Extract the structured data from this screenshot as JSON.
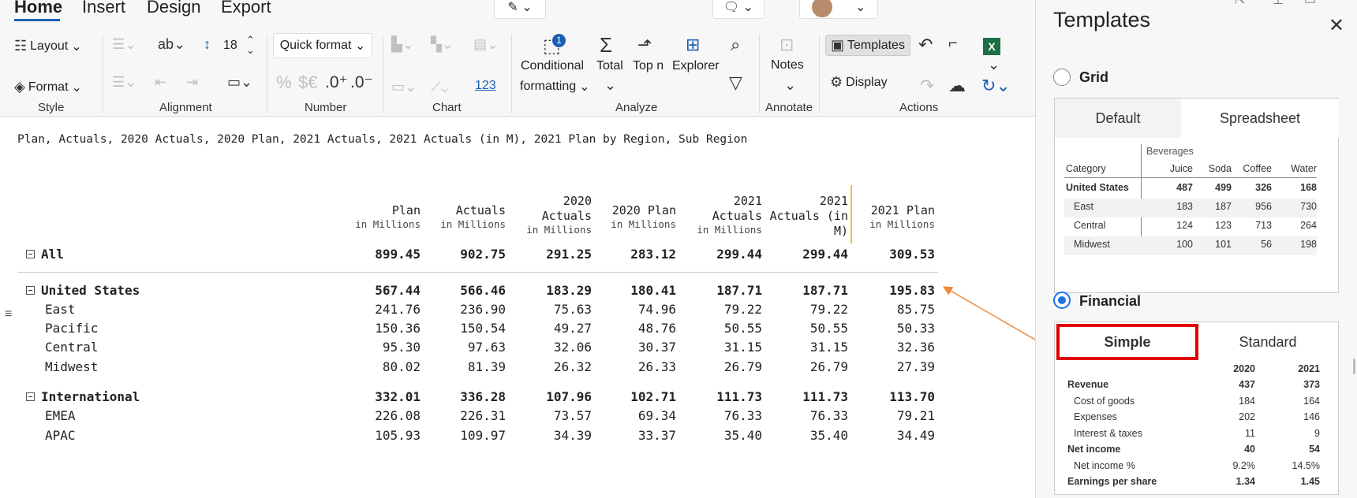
{
  "menu": {
    "home": "Home",
    "insert": "Insert",
    "design": "Design",
    "export": "Export"
  },
  "ribbon": {
    "style": {
      "layout": "Layout",
      "format": "Format",
      "label": "Style"
    },
    "alignment": {
      "label": "Alignment",
      "font_size": "18"
    },
    "number": {
      "quick_format": "Quick format",
      "label": "Number",
      "percent": "%",
      "currency": "$€",
      "inc_dec": ".0⁺",
      "dec_dec": ".0⁻"
    },
    "chart": {
      "label": "Chart",
      "num": "123"
    },
    "analyze": {
      "conditional1": "Conditional",
      "conditional2": "formatting",
      "badge": "1",
      "total": "Total",
      "topn": "Top n",
      "explorer": "Explorer",
      "label": "Analyze"
    },
    "annotate": {
      "notes": "Notes",
      "label": "Annotate"
    },
    "actions": {
      "templates": "Templates",
      "display": "Display",
      "label": "Actions"
    }
  },
  "formula": "Plan, Actuals, 2020 Actuals, 2020 Plan, 2021 Actuals, 2021 Actuals (in M), 2021 Plan by Region, Sub Region",
  "columns": [
    {
      "line1": "Plan",
      "line2": "",
      "sub": "in Millions"
    },
    {
      "line1": "Actuals",
      "line2": "",
      "sub": "in Millions"
    },
    {
      "line1": "2020",
      "line2": "Actuals",
      "sub": "in Millions"
    },
    {
      "line1": "2020 Plan",
      "line2": "",
      "sub": "in Millions"
    },
    {
      "line1": "2021",
      "line2": "Actuals",
      "sub": "in Millions"
    },
    {
      "line1": "2021",
      "line2": "Actuals (in",
      "sub": "M)"
    },
    {
      "line1": "2021 Plan",
      "line2": "",
      "sub": "in Millions"
    }
  ],
  "rows": [
    {
      "label": "All",
      "bold": true,
      "expand": true,
      "indent": 0,
      "values": [
        "899.45",
        "902.75",
        "291.25",
        "283.12",
        "299.44",
        "299.44",
        "309.53"
      ]
    },
    {
      "label": "United States",
      "bold": true,
      "expand": true,
      "indent": 0,
      "values": [
        "567.44",
        "566.46",
        "183.29",
        "180.41",
        "187.71",
        "187.71",
        "195.83"
      ]
    },
    {
      "label": "East",
      "bold": false,
      "expand": false,
      "indent": 1,
      "values": [
        "241.76",
        "236.90",
        "75.63",
        "74.96",
        "79.22",
        "79.22",
        "85.75"
      ]
    },
    {
      "label": "Pacific",
      "bold": false,
      "expand": false,
      "indent": 1,
      "values": [
        "150.36",
        "150.54",
        "49.27",
        "48.76",
        "50.55",
        "50.55",
        "50.33"
      ]
    },
    {
      "label": "Central",
      "bold": false,
      "expand": false,
      "indent": 1,
      "values": [
        "95.30",
        "97.63",
        "32.06",
        "30.37",
        "31.15",
        "31.15",
        "32.36"
      ]
    },
    {
      "label": "Midwest",
      "bold": false,
      "expand": false,
      "indent": 1,
      "values": [
        "80.02",
        "81.39",
        "26.32",
        "26.33",
        "26.79",
        "26.79",
        "27.39"
      ]
    },
    {
      "label": "International",
      "bold": true,
      "expand": true,
      "indent": 0,
      "values": [
        "332.01",
        "336.28",
        "107.96",
        "102.71",
        "111.73",
        "111.73",
        "113.70"
      ]
    },
    {
      "label": "EMEA",
      "bold": false,
      "expand": false,
      "indent": 1,
      "values": [
        "226.08",
        "226.31",
        "73.57",
        "69.34",
        "76.33",
        "76.33",
        "79.21"
      ]
    },
    {
      "label": "APAC",
      "bold": false,
      "expand": false,
      "indent": 1,
      "values": [
        "105.93",
        "109.97",
        "34.39",
        "33.37",
        "35.40",
        "35.40",
        "34.49"
      ]
    }
  ],
  "panel": {
    "title": "Templates",
    "grid": {
      "label": "Grid",
      "tabs": [
        "Default",
        "Spreadsheet"
      ],
      "group_header": "Beverages",
      "category_header": "Category",
      "columns": [
        "Juice",
        "Soda",
        "Coffee",
        "Water"
      ],
      "rows": [
        {
          "label": "United States",
          "bold": true,
          "values": [
            "487",
            "499",
            "326",
            "168"
          ]
        },
        {
          "label": "East",
          "bold": false,
          "values": [
            "183",
            "187",
            "956",
            "730"
          ]
        },
        {
          "label": "Central",
          "bold": false,
          "values": [
            "124",
            "123",
            "713",
            "264"
          ]
        },
        {
          "label": "Midwest",
          "bold": false,
          "values": [
            "100",
            "101",
            "56",
            "198"
          ]
        }
      ]
    },
    "financial": {
      "label": "Financial",
      "tabs": [
        "Simple",
        "Standard"
      ],
      "columns": [
        "2020",
        "2021"
      ],
      "rows": [
        {
          "label": "Revenue",
          "bold": true,
          "indent": 0,
          "values": [
            "437",
            "373"
          ]
        },
        {
          "label": "Cost of goods",
          "bold": false,
          "indent": 1,
          "values": [
            "184",
            "164"
          ]
        },
        {
          "label": "Expenses",
          "bold": false,
          "indent": 1,
          "values": [
            "202",
            "146"
          ]
        },
        {
          "label": "Interest & taxes",
          "bold": false,
          "indent": 1,
          "values": [
            "11",
            "9"
          ]
        },
        {
          "label": "Net income",
          "bold": true,
          "indent": 0,
          "values": [
            "40",
            "54"
          ]
        },
        {
          "label": "Net income %",
          "bold": false,
          "indent": 1,
          "values": [
            "9.2%",
            "14.5%"
          ]
        },
        {
          "label": "Earnings per share",
          "bold": true,
          "indent": 0,
          "values": [
            "1.34",
            "1.45"
          ]
        }
      ]
    }
  },
  "colors": {
    "accent": "#1a73e8",
    "highlight": "#e00000",
    "arrow": "#ee8a3c",
    "excel": "#1d7044"
  }
}
